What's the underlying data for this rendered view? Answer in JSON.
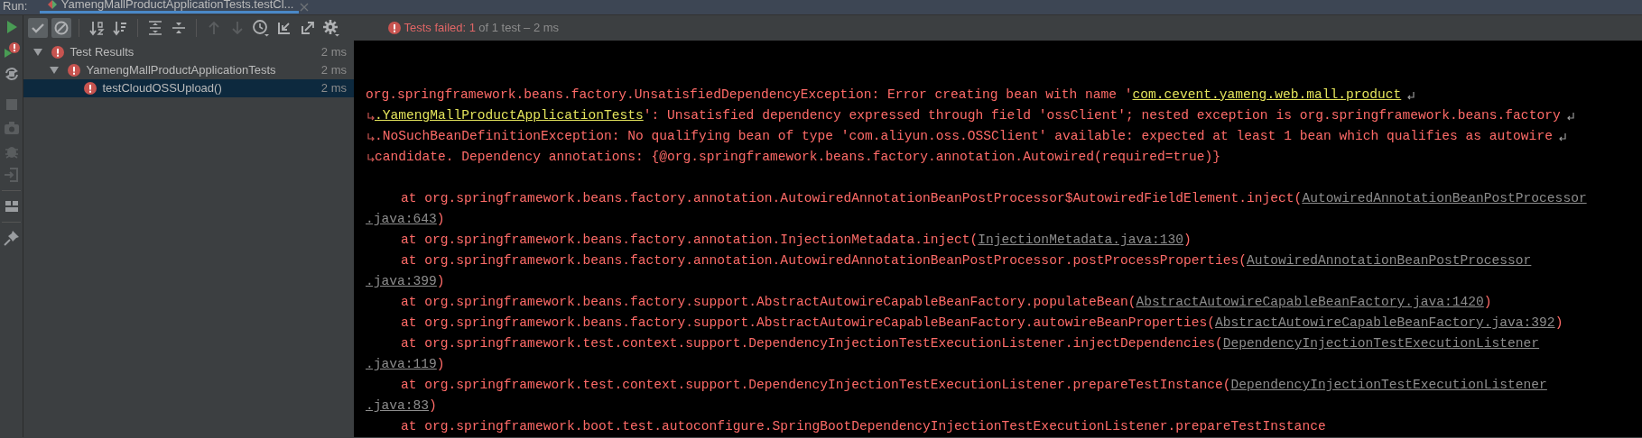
{
  "run_tab": {
    "label": "Run:",
    "title": "YamengMallProductApplicationTests.testCl...",
    "selected": true
  },
  "left_toolbar": [
    [
      {
        "kind": "run",
        "disabled": false
      },
      {
        "kind": "rerun-failed",
        "disabled": false
      },
      {
        "kind": "auto-test",
        "disabled": false
      },
      {
        "kind": "stop",
        "disabled": true
      },
      {
        "kind": "camera",
        "disabled": true
      },
      {
        "kind": "bug",
        "disabled": true
      },
      {
        "kind": "exit",
        "disabled": true
      }
    ],
    [
      {
        "kind": "layout",
        "disabled": false
      }
    ],
    [
      {
        "kind": "pin",
        "disabled": false
      }
    ]
  ],
  "toolbar": [
    [
      {
        "kind": "show-passed",
        "selected": true,
        "disabled": false
      },
      {
        "kind": "show-ignored",
        "selected": true,
        "disabled": false
      }
    ],
    [
      {
        "kind": "sort-alpha",
        "selected": false,
        "disabled": false
      },
      {
        "kind": "sort-duration",
        "selected": false,
        "disabled": false
      }
    ],
    [
      {
        "kind": "expand-all",
        "selected": false,
        "disabled": false
      },
      {
        "kind": "collapse-all",
        "selected": false,
        "disabled": false
      }
    ],
    [
      {
        "kind": "previous",
        "selected": false,
        "disabled": true
      },
      {
        "kind": "next",
        "selected": false,
        "disabled": true
      },
      {
        "kind": "history",
        "selected": false,
        "disabled": false
      },
      {
        "kind": "import",
        "selected": false,
        "disabled": false
      },
      {
        "kind": "export",
        "selected": false,
        "disabled": false
      },
      {
        "kind": "settings",
        "selected": false,
        "disabled": false
      }
    ]
  ],
  "status": {
    "failed": "Tests failed: 1",
    "summary": "of 1 test – 2 ms"
  },
  "tree": [
    {
      "label": "Test Results",
      "duration": "2 ms",
      "failed": true,
      "selected": false,
      "expanded": true,
      "children": [
        {
          "label": "YamengMallProductApplicationTests",
          "duration": "2 ms",
          "failed": true,
          "selected": false,
          "expanded": true,
          "children": [
            {
              "label": "testCloudOSSUpload()",
              "duration": "2 ms",
              "failed": true,
              "selected": true
            }
          ]
        }
      ]
    }
  ],
  "console": [
    {
      "kind": "blank"
    },
    {
      "kind": "blank"
    },
    {
      "kind": "message",
      "wrap_start": false,
      "wrap_end": true,
      "parts": [
        {
          "kind": "text",
          "text": "org.springframework.beans.factory.UnsatisfiedDependencyException: Error creating bean with name '"
        },
        {
          "kind": "highlight-link",
          "text": "com.cevent.yameng.web.mall.product"
        }
      ]
    },
    {
      "kind": "message",
      "wrap_start": true,
      "wrap_end": true,
      "parts": [
        {
          "kind": "highlight-link",
          "text": ".YamengMallProductApplicationTests"
        },
        {
          "kind": "text",
          "text": "': Unsatisfied dependency expressed through field 'ossClient'; nested exception is org.springframework.beans.factory"
        }
      ]
    },
    {
      "kind": "message",
      "wrap_start": true,
      "wrap_end": true,
      "parts": [
        {
          "kind": "text",
          "text": ".NoSuchBeanDefinitionException: No qualifying bean of type 'com.aliyun.oss.OSSClient' available: expected at least 1 bean which qualifies as autowire"
        }
      ]
    },
    {
      "kind": "message",
      "wrap_start": true,
      "wrap_end": false,
      "parts": [
        {
          "kind": "text",
          "text": "candidate. Dependency annotations: {@org.springframework.beans.factory.annotation.Autowired(required=true)}"
        }
      ]
    },
    {
      "kind": "blank"
    },
    {
      "kind": "frame",
      "parts": [
        {
          "kind": "text",
          "text": "at org.springframework.beans.factory.annotation.AutowiredAnnotationBeanPostProcessor$AutowiredFieldElement.inject("
        },
        {
          "kind": "link",
          "text": "AutowiredAnnotationBeanPostProcessor"
        }
      ]
    },
    {
      "kind": "continuation",
      "parts": [
        {
          "kind": "link",
          "text": ".java:643"
        },
        {
          "kind": "text",
          "text": ")"
        }
      ]
    },
    {
      "kind": "frame",
      "parts": [
        {
          "kind": "text",
          "text": "at org.springframework.beans.factory.annotation.InjectionMetadata.inject("
        },
        {
          "kind": "link",
          "text": "InjectionMetadata.java:130"
        },
        {
          "kind": "text",
          "text": ")"
        }
      ]
    },
    {
      "kind": "frame",
      "parts": [
        {
          "kind": "text",
          "text": "at org.springframework.beans.factory.annotation.AutowiredAnnotationBeanPostProcessor.postProcessProperties("
        },
        {
          "kind": "link",
          "text": "AutowiredAnnotationBeanPostProcessor"
        }
      ]
    },
    {
      "kind": "continuation",
      "parts": [
        {
          "kind": "link",
          "text": ".java:399"
        },
        {
          "kind": "text",
          "text": ")"
        }
      ]
    },
    {
      "kind": "frame",
      "parts": [
        {
          "kind": "text",
          "text": "at org.springframework.beans.factory.support.AbstractAutowireCapableBeanFactory.populateBean("
        },
        {
          "kind": "link",
          "text": "AbstractAutowireCapableBeanFactory.java:1420"
        },
        {
          "kind": "text",
          "text": ")"
        }
      ]
    },
    {
      "kind": "frame",
      "parts": [
        {
          "kind": "text",
          "text": "at org.springframework.beans.factory.support.AbstractAutowireCapableBeanFactory.autowireBeanProperties("
        },
        {
          "kind": "link",
          "text": "AbstractAutowireCapableBeanFactory.java:392"
        },
        {
          "kind": "text",
          "text": ")"
        }
      ]
    },
    {
      "kind": "frame",
      "parts": [
        {
          "kind": "text",
          "text": "at org.springframework.test.context.support.DependencyInjectionTestExecutionListener.injectDependencies("
        },
        {
          "kind": "link",
          "text": "DependencyInjectionTestExecutionListener"
        }
      ]
    },
    {
      "kind": "continuation",
      "parts": [
        {
          "kind": "link",
          "text": ".java:119"
        },
        {
          "kind": "text",
          "text": ")"
        }
      ]
    },
    {
      "kind": "frame",
      "parts": [
        {
          "kind": "text",
          "text": "at org.springframework.test.context.support.DependencyInjectionTestExecutionListener.prepareTestInstance("
        },
        {
          "kind": "link",
          "text": "DependencyInjectionTestExecutionListener"
        }
      ]
    },
    {
      "kind": "continuation",
      "parts": [
        {
          "kind": "link",
          "text": ".java:83"
        },
        {
          "kind": "text",
          "text": ")"
        }
      ]
    },
    {
      "kind": "frame",
      "parts": [
        {
          "kind": "text",
          "text": "at org.springframework.boot.test.autoconfigure.SpringBootDependencyInjectionTestExecutionListener.prepareTestInstance"
        }
      ]
    }
  ]
}
